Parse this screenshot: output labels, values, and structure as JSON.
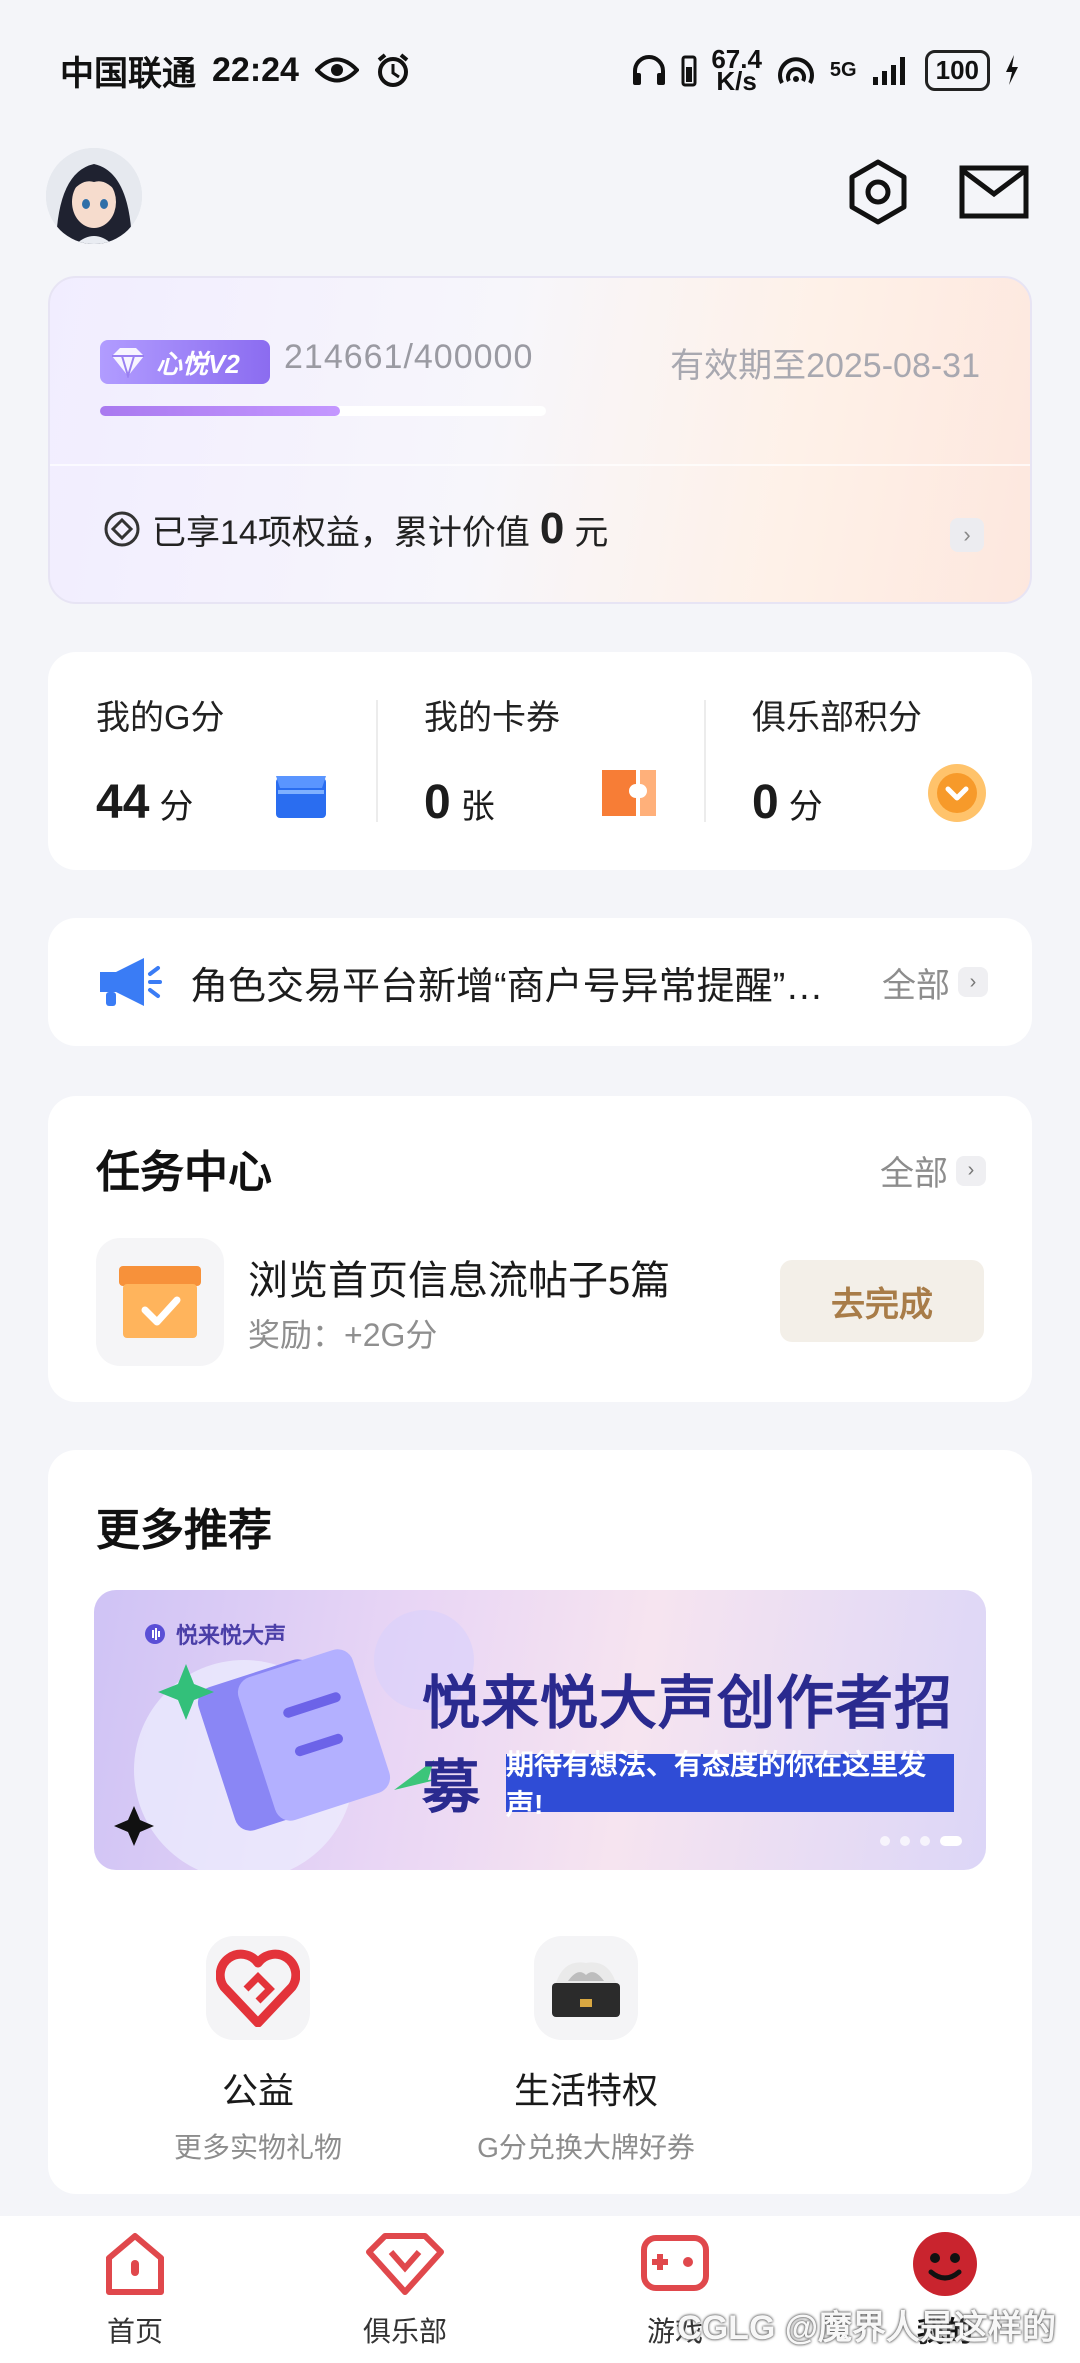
{
  "status_bar": {
    "carrier": "中国联通",
    "time": "22:24",
    "net_speed_value": "67.4",
    "net_speed_unit": "K/s",
    "signal": "5G",
    "battery": "100"
  },
  "vip": {
    "badge": "心悦V2",
    "progress_text": "214661/400000",
    "progress": 0.537,
    "expire": "有效期至2025-08-31",
    "benefit_prefix": "已享14项权益，累计价值",
    "benefit_value": "0",
    "benefit_unit": "元"
  },
  "stats": [
    {
      "label": "我的G分",
      "value": "44",
      "unit": "分"
    },
    {
      "label": "我的卡券",
      "value": "0",
      "unit": "张"
    },
    {
      "label": "俱乐部积分",
      "value": "0",
      "unit": "分"
    }
  ],
  "notice": {
    "text": "角色交易平台新增“商户号异常提醒”功能",
    "all_label": "全部"
  },
  "tasks": {
    "title": "任务中心",
    "all_label": "全部",
    "item": {
      "title": "浏览首页信息流帖子5篇",
      "reward": "奖励：+2G分",
      "button": "去完成"
    }
  },
  "recommend": {
    "title": "更多推荐",
    "banner": {
      "logo": "悦来悦大声",
      "title": "悦来悦大声创作者招募",
      "subtitle": "期待有想法、有态度的你在这里发声!"
    },
    "items": [
      {
        "name": "公益",
        "desc": "更多实物礼物"
      },
      {
        "name": "生活特权",
        "desc": "G分兑换大牌好券"
      }
    ]
  },
  "nav": [
    {
      "label": "首页"
    },
    {
      "label": "俱乐部"
    },
    {
      "label": "游戏"
    },
    {
      "label": "我的"
    }
  ],
  "watermark": "CGLG @魔界人是这样的",
  "colors": {
    "accent_purple": "#a979ef",
    "task_button_text": "#a87c48",
    "nav_red": "#e0484c",
    "background": "#f4f5f9"
  }
}
